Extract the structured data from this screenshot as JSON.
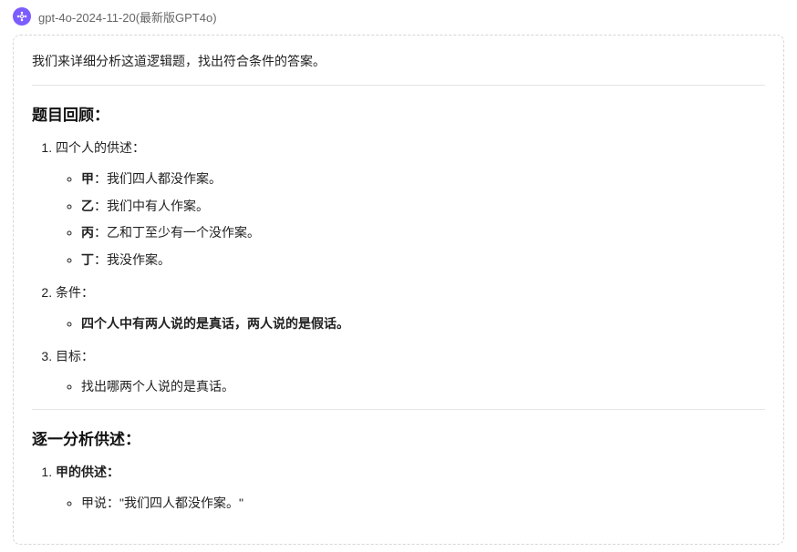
{
  "header": {
    "model_name": "gpt-4o-2024-11-20(最新版GPT4o)"
  },
  "content": {
    "intro": "我们来详细分析这道逻辑题，找出符合条件的答案。",
    "section1": {
      "title": "题目回顾：",
      "item1_label": "四个人的供述：",
      "statements": [
        {
          "who": "甲",
          "text": "：我们四人都没作案。"
        },
        {
          "who": "乙",
          "text": "：我们中有人作案。"
        },
        {
          "who": "丙",
          "text": "：乙和丁至少有一个没作案。"
        },
        {
          "who": "丁",
          "text": "：我没作案。"
        }
      ],
      "item2_label": "条件：",
      "condition": "四个人中有两人说的是真话，两人说的是假话。",
      "item3_label": "目标：",
      "goal": "找出哪两个人说的是真话。"
    },
    "section2": {
      "title": "逐一分析供述：",
      "item1_label": "甲的供述：",
      "line1": "甲说：\"我们四人都没作案。\""
    }
  }
}
